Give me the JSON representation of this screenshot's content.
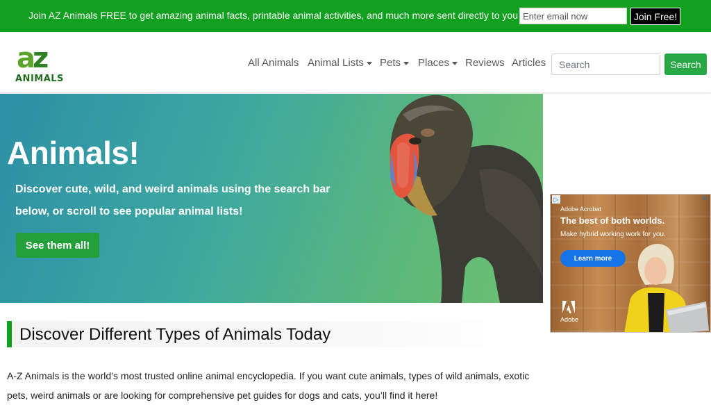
{
  "promo": {
    "text": "Join AZ Animals FREE to get amazing animal facts, printable animal activities, and much more sent directly to you",
    "email_placeholder": "Enter email now",
    "join_label": "Join Free!",
    "bg_color": "#11a01f"
  },
  "header": {
    "logo": {
      "top": "az",
      "word": "ANIMALS"
    },
    "nav": [
      {
        "label": "All Animals",
        "dropdown": false
      },
      {
        "label": "Animal Lists",
        "dropdown": true
      },
      {
        "label": "Pets",
        "dropdown": true
      },
      {
        "label": "Places",
        "dropdown": true
      },
      {
        "label": "Reviews",
        "dropdown": false
      },
      {
        "label": "Articles",
        "dropdown": false
      }
    ],
    "search_placeholder": "Search",
    "search_button": "Search",
    "accent_color": "#28a745"
  },
  "hero": {
    "title": "Animals!",
    "description": "Discover cute, wild, and weird animals using the search bar below, or scroll to see popular animal lists!",
    "cta": "See them all!"
  },
  "ad": {
    "brand": "Adobe Acrobat",
    "headline": "The best of both worlds.",
    "subline": "Make hybrid working work for you.",
    "cta": "Learn more",
    "footer_brand": "Adobe"
  },
  "content": {
    "section_title": "Discover Different Types of Animals Today",
    "paragraph": "A-Z Animals is the world’s most trusted online animal encyclopedia. If you want cute animals, types of wild animals, exotic pets, weird animals or are looking for comprehensive pet guides for dogs and cats, you’ll find it here!"
  }
}
